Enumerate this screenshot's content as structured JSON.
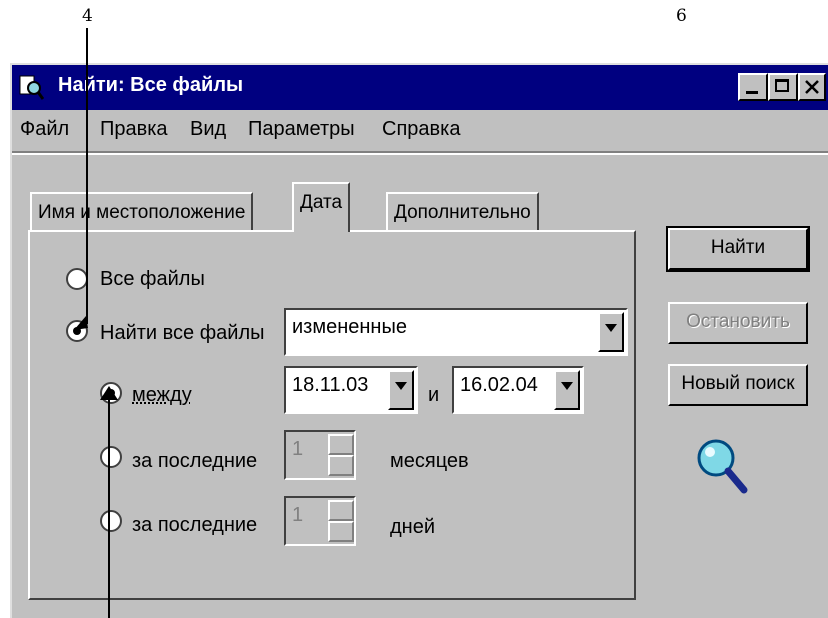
{
  "callouts": {
    "top_left": "4",
    "top_right": "6"
  },
  "window": {
    "title": "Найти: Все файлы",
    "controls": {
      "minimize": "_",
      "maximize": "□",
      "close": "x"
    }
  },
  "menu": [
    "Файл",
    "Правка",
    "Вид",
    "Параметры",
    "Справка"
  ],
  "tabs": [
    {
      "label": "Имя и местоположение"
    },
    {
      "label": "Дата",
      "active": true
    },
    {
      "label": "Дополнительно"
    }
  ],
  "date_tab": {
    "all_files": {
      "label": "Все файлы",
      "selected": false
    },
    "find_all": {
      "label": "Найти все файлы",
      "selected": true,
      "value": "измененные"
    },
    "between": {
      "label": "между",
      "selected": true,
      "from": "18.11.03",
      "conj": "и",
      "to": "16.02.04"
    },
    "last_months": {
      "label": "за последние",
      "value": "1",
      "unit": "месяцев",
      "selected": false
    },
    "last_days": {
      "label": "за последние",
      "value": "1",
      "unit": "дней",
      "selected": false
    }
  },
  "buttons": {
    "find": "Найти",
    "stop": "Остановить",
    "new_search": "Новый поиск"
  },
  "icons": {
    "title": "search-icon",
    "side": "magnifier-icon"
  }
}
